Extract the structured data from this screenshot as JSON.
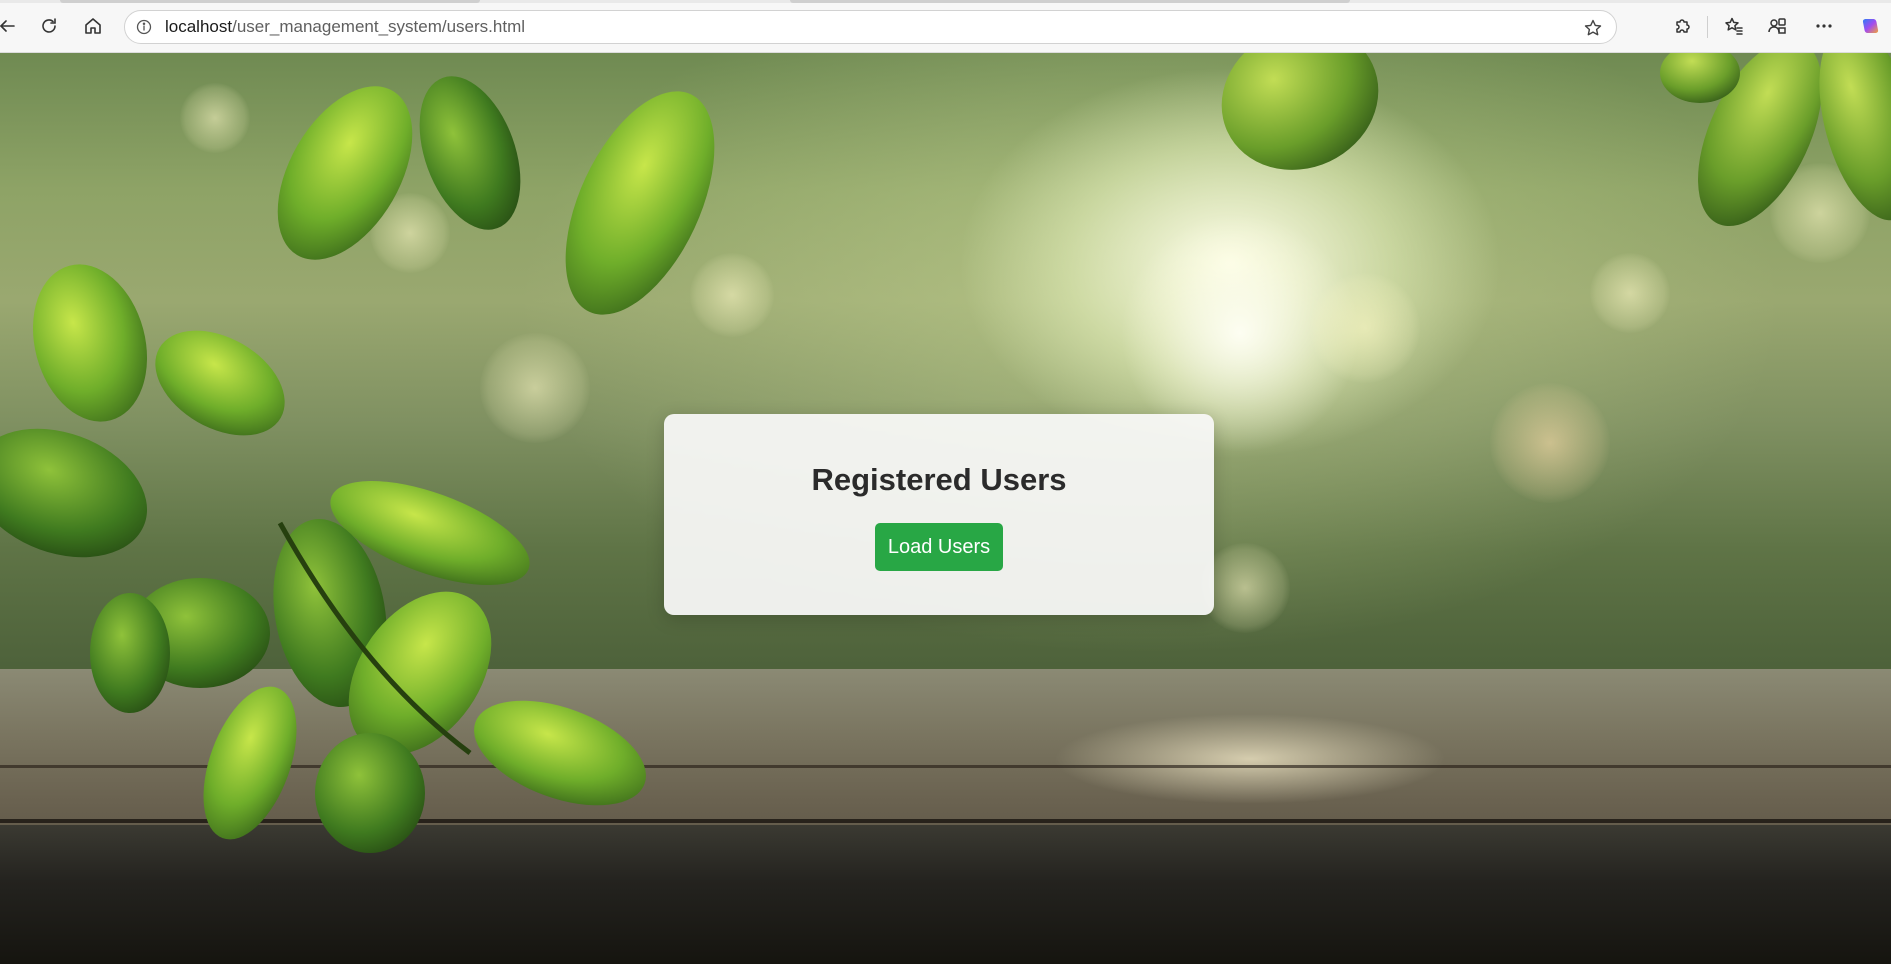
{
  "browser": {
    "url_host": "localhost",
    "url_path": "/user_management_system/users.html"
  },
  "page": {
    "title": "Registered Users",
    "load_button_label": "Load Users"
  },
  "colors": {
    "button_bg": "#28a745",
    "button_text": "#ffffff",
    "card_bg": "#f8f8f6",
    "title_text": "#2b2b2b"
  },
  "icons": {
    "back": "back-arrow-icon",
    "refresh": "refresh-icon",
    "home": "home-icon",
    "site_info": "info-icon",
    "favorite": "star-icon",
    "extensions": "puzzle-icon",
    "favorites": "favorites-icon",
    "profile": "profile-share-icon",
    "more": "more-icon",
    "copilot": "copilot-icon"
  }
}
